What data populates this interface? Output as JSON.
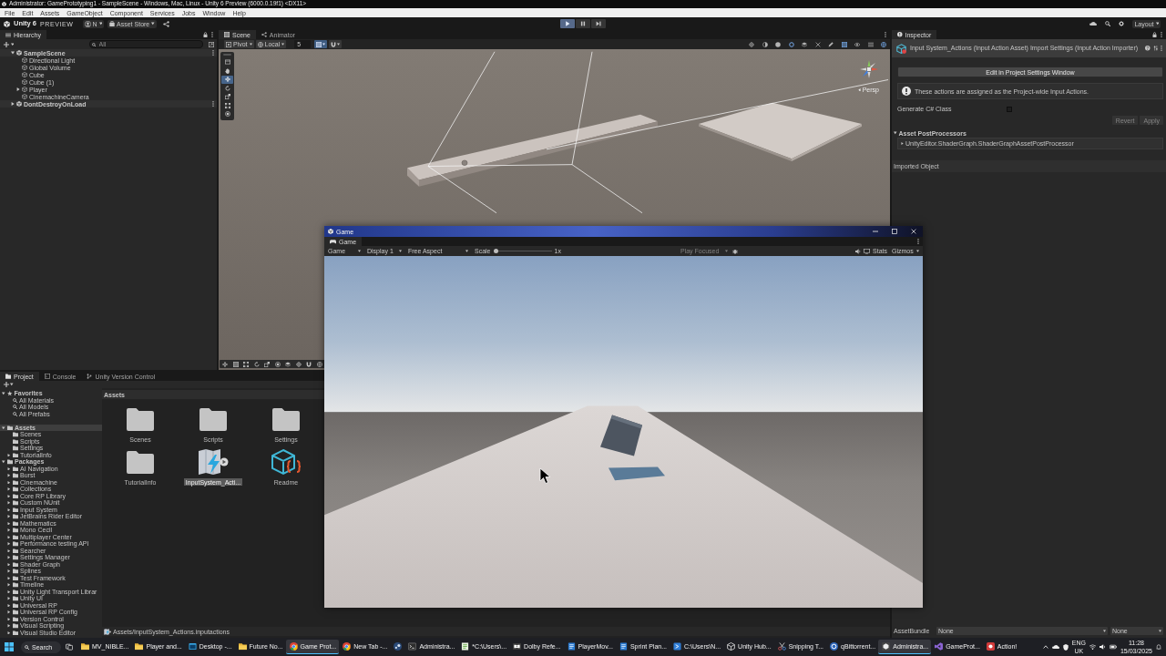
{
  "title_bar": {
    "title": "Administrator: GamePrototyping1 - SampleScene - Windows, Mac, Linux - Unity 6 Preview (6000.0.19f1) <DX11>"
  },
  "menu_bar": {
    "items": [
      "File",
      "Edit",
      "Assets",
      "GameObject",
      "Component",
      "Services",
      "Jobs",
      "Window",
      "Help"
    ]
  },
  "toolbar": {
    "product": "Unity 6",
    "edition": "PREVIEW",
    "account": "N",
    "store": "Asset Store",
    "play_controls": [
      {
        "kind": "play",
        "on": true
      },
      {
        "kind": "pause",
        "on": false
      },
      {
        "kind": "step",
        "on": false
      }
    ],
    "layout": "Layout"
  },
  "hierarchy": {
    "tab": "Hierarchy",
    "search": {
      "placeholder": "All"
    },
    "tree": [
      {
        "label": "SampleScene",
        "kind": "scene",
        "expanded": true,
        "children": [
          {
            "label": "Directional Light",
            "kind": "object"
          },
          {
            "label": "Global Volume",
            "kind": "object"
          },
          {
            "label": "Cube",
            "kind": "object"
          },
          {
            "label": "Cube (1)",
            "kind": "object"
          },
          {
            "label": "Player",
            "kind": "object",
            "expanded": false
          },
          {
            "label": "CinemachineCamera",
            "kind": "object"
          }
        ]
      },
      {
        "label": "DontDestroyOnLoad",
        "kind": "scene",
        "expanded": false
      }
    ]
  },
  "scene_view": {
    "tabs": [
      {
        "label": "Scene",
        "kind": "scene",
        "selected": true
      },
      {
        "label": "Animator",
        "kind": "animator",
        "selected": false
      }
    ],
    "pivot": "Pivot",
    "space": "Local",
    "grid_size": "5",
    "toggles": [
      {
        "kind": "grid",
        "on": true
      },
      {
        "kind": "magnet",
        "on": false
      }
    ],
    "view_options": [
      {
        "kind": "crosshair",
        "on": false
      },
      {
        "kind": "half-moon",
        "on": false
      },
      {
        "kind": "dot",
        "on": false
      },
      {
        "kind": "ring",
        "on": true
      },
      {
        "kind": "layers",
        "on": false
      },
      {
        "kind": "cross",
        "on": false
      },
      {
        "kind": "pen",
        "on": false
      },
      {
        "kind": "grid",
        "on": true
      },
      {
        "kind": "eye",
        "on": false
      },
      {
        "kind": "list",
        "on": false
      },
      {
        "kind": "globe",
        "on": true
      }
    ],
    "tools": [
      {
        "kind": "window",
        "selected": false
      },
      {
        "kind": "hand",
        "selected": false
      },
      {
        "kind": "move",
        "selected": true
      },
      {
        "kind": "rotate",
        "selected": false
      },
      {
        "kind": "scale",
        "selected": false
      },
      {
        "kind": "rect",
        "selected": false
      },
      {
        "kind": "transform",
        "selected": false
      }
    ],
    "projection": "Persp"
  },
  "inspector": {
    "tab": "Inspector",
    "header": "Input System_Actions (Input Action Asset) Import Settings (Input Action Importer)",
    "edit_button": "Edit in Project Settings Window",
    "info": "These actions are assigned as the Project-wide Input Actions.",
    "generate_class": {
      "label": "Generate C# Class",
      "checked": false
    },
    "buttons": [
      {
        "label": "Revert",
        "disabled": true
      },
      {
        "label": "Apply",
        "disabled": true
      }
    ],
    "post_processors": {
      "title": "Asset PostProcessors",
      "expanded": true,
      "items": [
        {
          "label": "UnityEditor.ShaderGraph.ShaderGraphAssetPostProcessor",
          "expanded": false
        }
      ]
    },
    "imported_object": "Imported Object",
    "asset_bundle": {
      "label": "AssetBundle",
      "name": "None",
      "variant": "None"
    }
  },
  "project": {
    "tabs": [
      {
        "label": "Project",
        "kind": "project",
        "selected": true
      },
      {
        "label": "Console",
        "kind": "console",
        "selected": false
      },
      {
        "label": "Unity Version Control",
        "kind": "version-control",
        "selected": false
      }
    ],
    "tree": [
      {
        "label": "Favorites",
        "kind": "favorites",
        "expanded": true,
        "selected": false,
        "children": [
          {
            "label": "All Materials",
            "kind": "search",
            "selected": false
          },
          {
            "label": "All Models",
            "kind": "search",
            "selected": false
          },
          {
            "label": "All Prefabs",
            "kind": "search",
            "selected": false
          }
        ]
      },
      {
        "label": "Assets",
        "kind": "folder",
        "expanded": true,
        "selected": true,
        "children": [
          {
            "label": "Scenes",
            "kind": "folder",
            "selected": false
          },
          {
            "label": "Scripts",
            "kind": "folder",
            "selected": false
          },
          {
            "label": "Settings",
            "kind": "folder",
            "selected": false
          },
          {
            "label": "TutorialInfo",
            "kind": "folder",
            "expanded": false,
            "selected": false
          }
        ]
      },
      {
        "label": "Packages",
        "kind": "folder",
        "expanded": true,
        "selected": false,
        "children": [
          {
            "label": "AI Navigation",
            "kind": "folder",
            "expanded": false,
            "selected": false
          },
          {
            "label": "Burst",
            "kind": "folder",
            "expanded": false,
            "selected": false
          },
          {
            "label": "Cinemachine",
            "kind": "folder",
            "expanded": false,
            "selected": false
          },
          {
            "label": "Collections",
            "kind": "folder",
            "expanded": false,
            "selected": false
          },
          {
            "label": "Core RP Library",
            "kind": "folder",
            "expanded": false,
            "selected": false
          },
          {
            "label": "Custom NUnit",
            "kind": "folder",
            "expanded": false,
            "selected": false
          },
          {
            "label": "Input System",
            "kind": "folder",
            "expanded": false,
            "selected": false
          },
          {
            "label": "JetBrains Rider Editor",
            "kind": "folder",
            "expanded": false,
            "selected": false
          },
          {
            "label": "Mathematics",
            "kind": "folder",
            "expanded": false,
            "selected": false
          },
          {
            "label": "Mono Cecil",
            "kind": "folder",
            "expanded": false,
            "selected": false
          },
          {
            "label": "Multiplayer Center",
            "kind": "folder",
            "expanded": false,
            "selected": false
          },
          {
            "label": "Performance testing API",
            "kind": "folder",
            "expanded": false,
            "selected": false
          },
          {
            "label": "Searcher",
            "kind": "folder",
            "expanded": false,
            "selected": false
          },
          {
            "label": "Settings Manager",
            "kind": "folder",
            "expanded": false,
            "selected": false
          },
          {
            "label": "Shader Graph",
            "kind": "folder",
            "expanded": false,
            "selected": false
          },
          {
            "label": "Splines",
            "kind": "folder",
            "expanded": false,
            "selected": false
          },
          {
            "label": "Test Framework",
            "kind": "folder",
            "expanded": false,
            "selected": false
          },
          {
            "label": "Timeline",
            "kind": "folder",
            "expanded": false,
            "selected": false
          },
          {
            "label": "Unity Light Transport Librar",
            "kind": "folder",
            "expanded": false,
            "selected": false
          },
          {
            "label": "Unity UI",
            "kind": "folder",
            "expanded": false,
            "selected": false
          },
          {
            "label": "Universal RP",
            "kind": "folder",
            "expanded": false,
            "selected": false
          },
          {
            "label": "Universal RP Config",
            "kind": "folder",
            "expanded": false,
            "selected": false
          },
          {
            "label": "Version Control",
            "kind": "folder",
            "expanded": false,
            "selected": false
          },
          {
            "label": "Visual Scripting",
            "kind": "folder",
            "expanded": false,
            "selected": false
          },
          {
            "label": "Visual Studio Editor",
            "kind": "folder",
            "expanded": false,
            "selected": false
          }
        ]
      }
    ],
    "breadcrumb": "Assets",
    "assets": [
      {
        "label": "Scenes",
        "kind": "folder",
        "selected": false
      },
      {
        "label": "Scripts",
        "kind": "folder",
        "selected": false
      },
      {
        "label": "Settings",
        "kind": "folder",
        "selected": false
      },
      {
        "label": "TutorialInfo",
        "kind": "folder",
        "selected": false
      },
      {
        "label": "InputSystem_Acti...",
        "kind": "input-actions",
        "selected": true
      },
      {
        "label": "Readme",
        "kind": "readme",
        "selected": false
      }
    ],
    "path": "Assets/InputSystem_Actions.inputactions"
  },
  "game_window": {
    "title": "Game",
    "tab": "Game",
    "view": "Game",
    "display": "Display 1",
    "aspect": "Free Aspect",
    "scale": {
      "label": "Scale",
      "level": 0,
      "reading": "1x"
    },
    "play_mode": {
      "label": "Play Focused",
      "disabled": true
    },
    "stats": "Stats",
    "gizmos": "Gizmos"
  },
  "taskbar": {
    "search": {
      "placeholder": "Search"
    },
    "apps": [
      {
        "label": "MV_NIBLE...",
        "kind": "folder",
        "selected": false
      },
      {
        "label": "Player and...",
        "kind": "folder",
        "selected": false
      },
      {
        "label": "Desktop -...",
        "kind": "window",
        "selected": false
      },
      {
        "label": "Future No...",
        "kind": "folder",
        "selected": false
      },
      {
        "label": "Game Prot...",
        "kind": "browser",
        "selected": true
      },
      {
        "label": "New Tab -...",
        "kind": "browser",
        "selected": false
      },
      {
        "kind": "game-client",
        "selected": false
      },
      {
        "label": "Administra...",
        "kind": "terminal",
        "selected": false
      },
      {
        "label": "*C:\\Users\\...",
        "kind": "notepad",
        "selected": false
      },
      {
        "label": "Dolby Refe...",
        "kind": "audio",
        "selected": false
      },
      {
        "label": "PlayerMov...",
        "kind": "document",
        "selected": false
      },
      {
        "label": "Sprint Plan...",
        "kind": "document",
        "selected": false
      },
      {
        "label": "C:\\Users\\N...",
        "kind": "editor",
        "selected": false
      },
      {
        "label": "Unity Hub...",
        "kind": "cube",
        "selected": false
      },
      {
        "label": "Snipping T...",
        "kind": "snip",
        "selected": false
      },
      {
        "label": "qBittorrent...",
        "kind": "torrent",
        "selected": false
      },
      {
        "label": "Administra...",
        "kind": "unity",
        "selected": true
      },
      {
        "label": "GameProt...",
        "kind": "ide",
        "selected": false
      },
      {
        "label": "Action!",
        "kind": "recorder",
        "selected": false
      }
    ],
    "language": "ENG",
    "region": "UK",
    "time": "11:28",
    "date": "15/03/2025"
  }
}
